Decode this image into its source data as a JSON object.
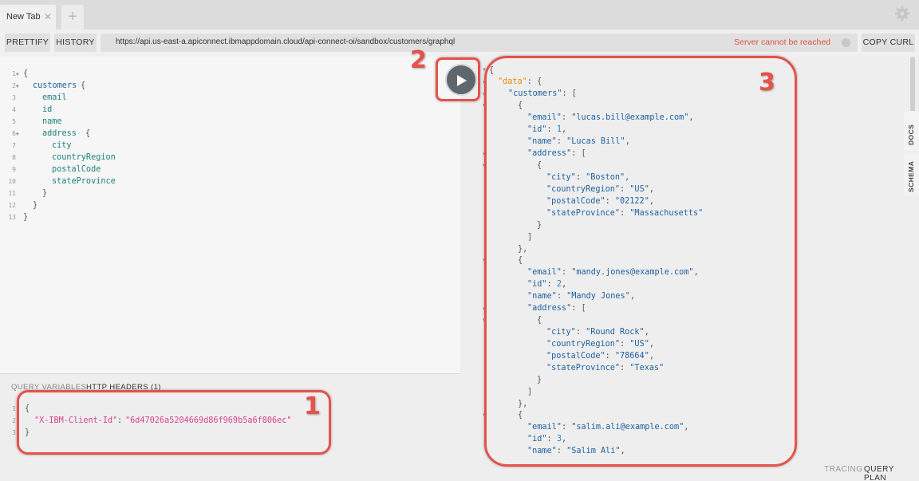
{
  "tabs": {
    "active_title": "New Tab",
    "close_glyph": "✕",
    "new_tab_glyph": "+"
  },
  "toolbar": {
    "prettify_label": "PRETTIFY",
    "history_label": "HISTORY",
    "endpoint_url": "https://api.us-east-a.apiconnect.ibmappdomain.cloud/api-connect-oi/sandbox/customers/graphql",
    "server_status": "Server cannot be reached",
    "copy_curl_label": "COPY CURL"
  },
  "query_editor": {
    "line_numbers": [
      "1",
      "2",
      "3",
      "4",
      "5",
      "6",
      "7",
      "8",
      "9",
      "10",
      "11",
      "12",
      "13"
    ],
    "open_brace": "{",
    "root_field": "customers",
    "fields": [
      "email",
      "id",
      "name"
    ],
    "nested_field": "address",
    "nested_fields": [
      "city",
      "countryRegion",
      "postalCode",
      "stateProvince"
    ],
    "close_brace": "}"
  },
  "variables_pane": {
    "tab_query_variables": "QUERY VARIABLES",
    "tab_http_headers": "HTTP HEADERS (1)",
    "line_numbers": [
      "1",
      "2",
      "3"
    ],
    "header_key": "\"X-IBM-Client-Id\"",
    "header_value": "\"6d47026a5204669d86f969b5a6f806ec\""
  },
  "run_button": {
    "icon": "play-icon"
  },
  "result": {
    "data_key": "\"data\"",
    "customers_key": "\"customers\"",
    "customers": [
      {
        "email": "\"lucas.bill@example.com\"",
        "id": "1",
        "name": "\"Lucas Bill\"",
        "city": "\"Boston\"",
        "countryRegion": "\"US\"",
        "postalCode": "\"02122\"",
        "stateProvince": "\"Massachusetts\""
      },
      {
        "email": "\"mandy.jones@example.com\"",
        "id": "2",
        "name": "\"Mandy Jones\"",
        "city": "\"Round Rock\"",
        "countryRegion": "\"US\"",
        "postalCode": "\"78664\"",
        "stateProvince": "\"Texas\""
      },
      {
        "email": "\"salim.ali@example.com\"",
        "id": "3",
        "name": "\"Salim Ali\""
      }
    ],
    "keys": {
      "email": "\"email\"",
      "id": "\"id\"",
      "name": "\"name\"",
      "address": "\"address\"",
      "city": "\"city\"",
      "countryRegion": "\"countryRegion\"",
      "postalCode": "\"postalCode\"",
      "stateProvince": "\"stateProvince\""
    }
  },
  "sidebar": {
    "docs_label": "DOCS",
    "schema_label": "SCHEMA"
  },
  "footer": {
    "tracing_label": "TRACING",
    "query_plan_label": "QUERY PLAN"
  },
  "annotations": {
    "one": "1",
    "two": "2",
    "three": "3"
  },
  "colors": {
    "annotation": "#e5524a",
    "error": "#e0543b",
    "keyword": "#1f61a0",
    "header": "#d64292"
  }
}
